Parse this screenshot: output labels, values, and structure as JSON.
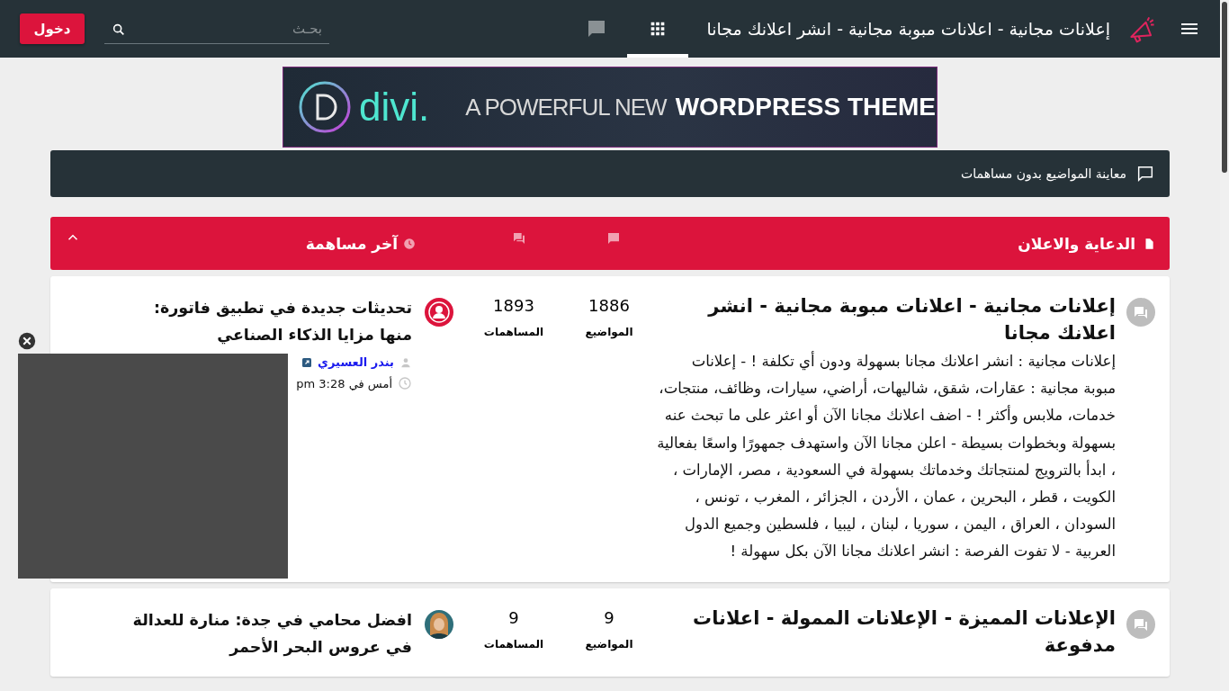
{
  "header": {
    "title": "إعلانات مجانية - اعلانات مبوبة مجانية - انشر اعلانك مجانا",
    "nav": [
      {
        "kind": "apps",
        "selected": true
      },
      {
        "kind": "chat",
        "selected": false
      }
    ],
    "search": {
      "placeholder": "بحـث"
    },
    "login": "دخول"
  },
  "banner": {
    "logo": "divi.",
    "tagline_light": "A POWERFUL NEW",
    "tagline_bold": "WORDPRESS THEME"
  },
  "notice": "معاينة المواضيع بدون مساهمات",
  "category": {
    "title": "الدعاية والاعلان",
    "last_post_heading": "آخر مساهمة",
    "expanded": true
  },
  "forums": [
    {
      "title": "إعلانات مجانية - اعلانات مبوبة مجانية - انشر اعلانك مجانا",
      "description": "إعلانات مجانية : انشر اعلانك مجانا بسهولة ودون أي تكلفة ! - إعلانات مبوبة مجانية : عقارات، شقق، شاليهات، أراضي، سيارات، وظائف، منتجات، خدمات، ملابس وأكثر ! - اضف اعلانك مجانا الآن أو اعثر على ما تبحث عنه بسهولة وبخطوات بسيطة - اعلن مجانا الآن واستهدف جمهورًا واسعًا بفعالية ، ابدأ بالترويج لمنتجاتك وخدماتك بسهولة في السعودية ، مصر، الإمارات ، الكويت ، قطر ، البحرين ، عمان ، الأردن ، الجزائر ، المغرب ، تونس ، السودان ، العراق ، اليمن ، سوريا ، لبنان ، ليبيا ، فلسطين وجميع الدول العربية - لا تفوت الفرصة : انشر اعلانك مجانا الآن بكل سهولة !",
      "topics": "1886",
      "topics_label": "المواضيع",
      "posts": "1893",
      "posts_label": "المساهمات",
      "avatar": {
        "kind": "default"
      },
      "last_post": {
        "title": "تحديثات جديدة في تطبيق فاتورة: منها مزايا الذكاء الصناعي",
        "author": "بندر العسيري",
        "time": "أمس في 3:28 pm"
      }
    },
    {
      "title": "الإعلانات المميزة - الإعلانات الممولة - اعلانات مدفوعة",
      "topics": "9",
      "topics_label": "المواضيع",
      "posts": "9",
      "posts_label": "المساهمات",
      "last_post": {
        "title": "افضل محامي في جدة: منارة للعدالة في عروس البحر الأحمر"
      }
    }
  ],
  "floating_ad": {
    "dismissible": true
  }
}
